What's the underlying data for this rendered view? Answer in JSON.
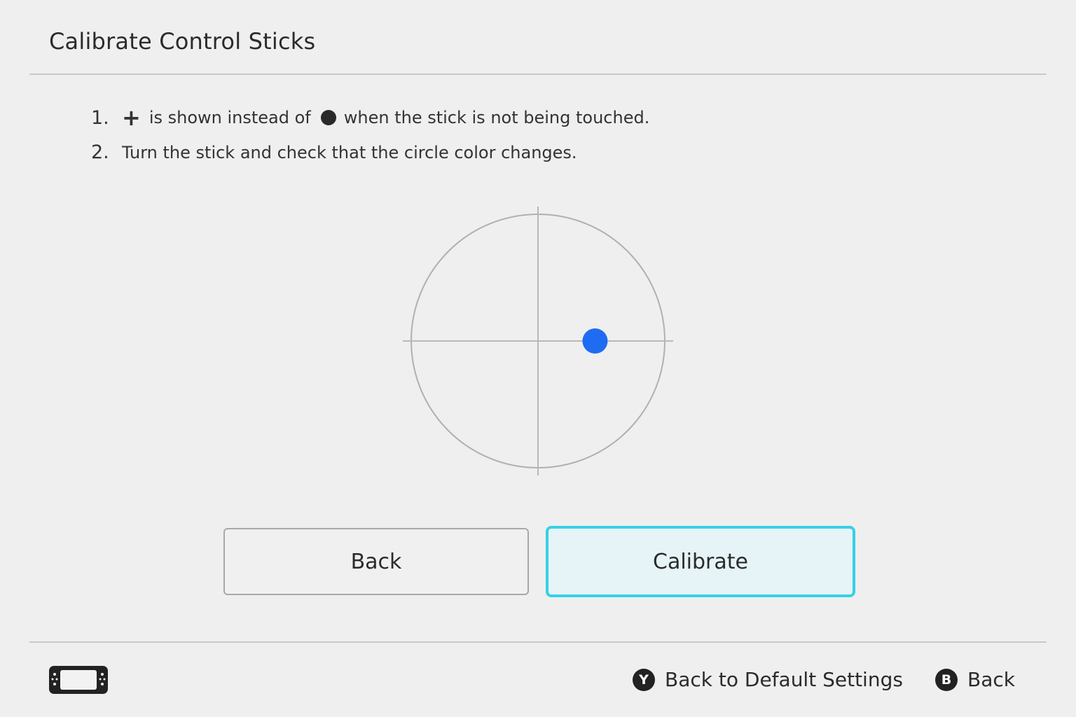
{
  "header": {
    "title": "Calibrate Control Sticks"
  },
  "instructions": [
    {
      "number": "1.",
      "icon_plus": "+",
      "text_a": "is shown instead of",
      "text_b": "when the stick is not being touched."
    },
    {
      "number": "2.",
      "text": "Turn the stick and check that the circle color changes."
    }
  ],
  "stick_display": {
    "indicator_color": "#1f6bf2",
    "position": {
      "x": 0.45,
      "y": 0.0
    }
  },
  "buttons": {
    "back": "Back",
    "calibrate": "Calibrate"
  },
  "footer": {
    "device_icon": "handheld-console-icon",
    "actions": [
      {
        "glyph": "Y",
        "label": "Back to Default Settings"
      },
      {
        "glyph": "B",
        "label": "Back"
      }
    ]
  },
  "colors": {
    "focus": "#36d1e6",
    "indicator": "#1f6bf2",
    "background": "#efefef"
  }
}
